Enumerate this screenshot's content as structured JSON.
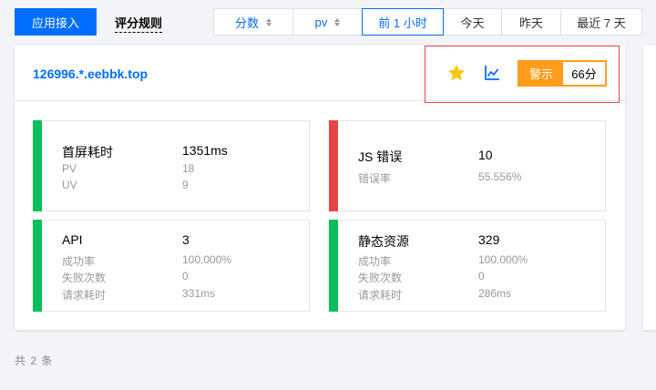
{
  "toolbar": {
    "connect_label": "应用接入",
    "rules_label": "评分规则",
    "filters": [
      {
        "label": "分数",
        "sortable": true
      },
      {
        "label": "pv",
        "sortable": true
      },
      {
        "label": "前 1 小时",
        "active": true
      },
      {
        "label": "今天"
      },
      {
        "label": "昨天"
      },
      {
        "label": "最近 7 天"
      }
    ]
  },
  "card": {
    "site": "126996.*.eebbk.top",
    "alert_label": "警示",
    "score": "66分",
    "metrics": {
      "first_screen": {
        "title": "首屏耗时",
        "value": "1351ms",
        "rows": [
          {
            "label": "PV",
            "value": "18"
          },
          {
            "label": "UV",
            "value": "9"
          }
        ]
      },
      "js_error": {
        "title": "JS 错误",
        "value": "10",
        "rows": [
          {
            "label": "错误率",
            "value": "55.556%"
          }
        ]
      },
      "api": {
        "title": "API",
        "value": "3",
        "rows": [
          {
            "label": "成功率",
            "value": "100.000%"
          },
          {
            "label": "失败次数",
            "value": "0"
          },
          {
            "label": "请求耗时",
            "value": "331ms"
          }
        ]
      },
      "static": {
        "title": "静态资源",
        "value": "329",
        "rows": [
          {
            "label": "成功率",
            "value": "100.000%"
          },
          {
            "label": "失败次数",
            "value": "0"
          },
          {
            "label": "请求耗时",
            "value": "286ms"
          }
        ]
      }
    }
  },
  "footer": {
    "total": "共 2 条"
  },
  "colors": {
    "primary": "#006eff",
    "good": "#0abf5b",
    "bad": "#e54545",
    "warning": "#ff9c19",
    "star": "#ffc300"
  },
  "icons": {
    "star": "star-icon",
    "chart": "line-chart-icon",
    "sort": "sort-icon"
  }
}
